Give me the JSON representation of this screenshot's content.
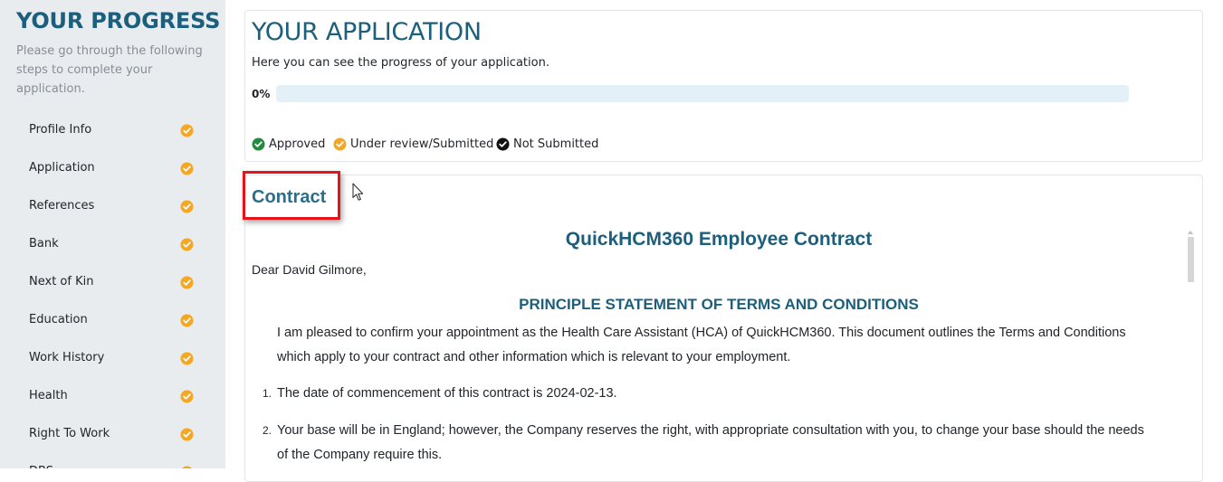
{
  "sidebar": {
    "title": "YOUR PROGRESS",
    "description": "Please go through the following steps to complete your application.",
    "items": [
      {
        "label": "Profile Info",
        "status": "under-review"
      },
      {
        "label": "Application",
        "status": "under-review"
      },
      {
        "label": "References",
        "status": "under-review"
      },
      {
        "label": "Bank",
        "status": "under-review"
      },
      {
        "label": "Next of Kin",
        "status": "under-review"
      },
      {
        "label": "Education",
        "status": "under-review"
      },
      {
        "label": "Work History",
        "status": "under-review"
      },
      {
        "label": "Health",
        "status": "under-review"
      },
      {
        "label": "Right To Work",
        "status": "under-review"
      },
      {
        "label": "DBS",
        "status": "under-review"
      }
    ]
  },
  "application": {
    "title": "YOUR APPLICATION",
    "subtitle": "Here you can see the progress of your application.",
    "progress_label": "0%",
    "progress_value": 0,
    "legend": [
      {
        "label": "Approved",
        "color": "#1e8e3e"
      },
      {
        "label": "Under review/Submitted",
        "color": "#f5a623"
      },
      {
        "label": "Not Submitted",
        "color": "#111111"
      }
    ]
  },
  "contract": {
    "heading": "Contract",
    "doc_title": "QuickHCM360 Employee Contract",
    "greeting": "Dear David Gilmore,",
    "section_title": "PRINCIPLE STATEMENT OF TERMS AND CONDITIONS",
    "intro": "I am pleased to confirm your appointment as the Health Care Assistant (HCA) of QuickHCM360. This document outlines the Terms and Conditions which apply to your contract and other information which is relevant to your employment.",
    "items": [
      {
        "num": "1.",
        "text": "The date of commencement of this contract is 2024-02-13."
      },
      {
        "num": "2.",
        "text": "Your base will be in England; however, the Company reserves the right, with appropriate consultation with you, to change your base should the needs of the Company require this."
      }
    ]
  },
  "colors": {
    "brand": "#1c5f7c",
    "under_review": "#f5a623",
    "approved": "#1e8e3e",
    "not_submitted": "#111111",
    "highlight": "#e8121b"
  }
}
